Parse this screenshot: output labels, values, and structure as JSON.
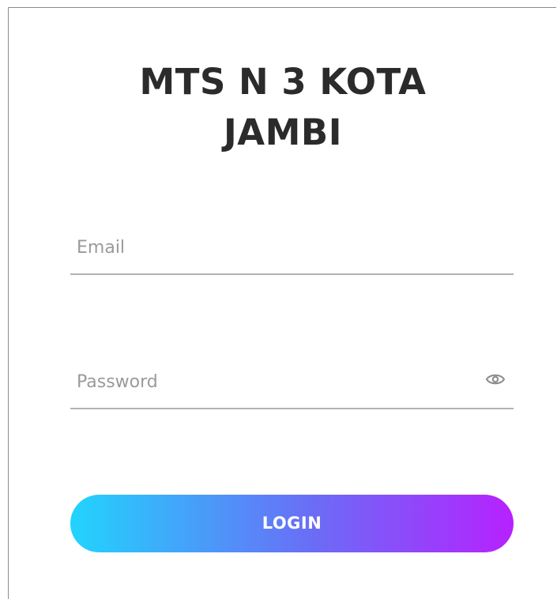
{
  "header": {
    "title_line1": "MTS N 3 KOTA",
    "title_line2": "JAMBI"
  },
  "form": {
    "email": {
      "placeholder": "Email",
      "value": ""
    },
    "password": {
      "placeholder": "Password",
      "value": "",
      "toggle_icon": "eye-icon"
    },
    "login_label": "LOGIN"
  },
  "colors": {
    "gradient_start": "#21d4fd",
    "gradient_end": "#b721ff",
    "title": "#2b2b2b",
    "underline": "#b2b2b2",
    "placeholder": "#9a9a9a"
  }
}
